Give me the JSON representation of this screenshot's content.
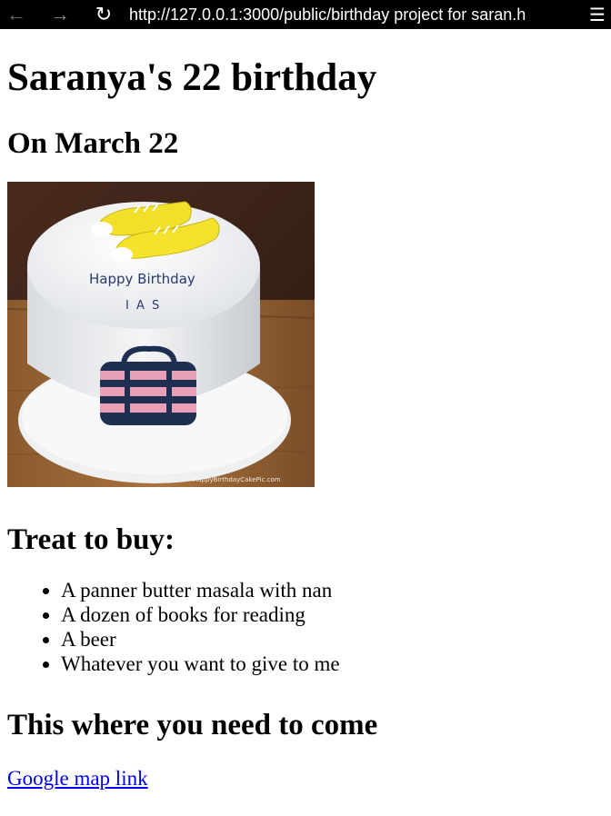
{
  "browser": {
    "url": "http://127.0.0.1:3000/public/birthday project for saran.h",
    "back_icon": "←",
    "forward_icon": "→",
    "reload_icon": "↻",
    "menu_icon": "☰"
  },
  "page": {
    "title": "Saranya's 22 birthday",
    "date": "On March 22",
    "cake_image": {
      "cake_text_line1": "Happy Birthday",
      "cake_text_line2": "I A S",
      "watermark": "HappyBirthdayCakePic.com"
    },
    "treat_heading": "Treat to buy:",
    "treats": [
      "A panner butter masala with nan",
      "A dozen of books for reading",
      "A beer",
      "Whatever you want to give to me"
    ],
    "location_heading": "This where you need to come",
    "map_link_text": "Google map link"
  }
}
